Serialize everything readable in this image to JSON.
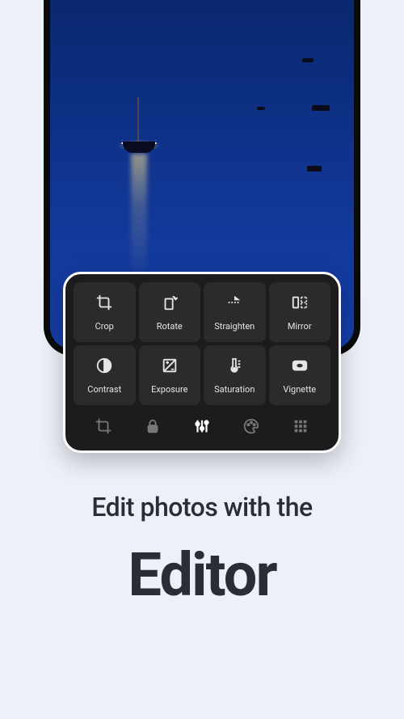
{
  "tools": [
    {
      "id": "crop",
      "label": "Crop"
    },
    {
      "id": "rotate",
      "label": "Rotate"
    },
    {
      "id": "straighten",
      "label": "Straighten"
    },
    {
      "id": "mirror",
      "label": "Mirror"
    },
    {
      "id": "contrast",
      "label": "Contrast"
    },
    {
      "id": "exposure",
      "label": "Exposure"
    },
    {
      "id": "saturation",
      "label": "Saturation"
    },
    {
      "id": "vignette",
      "label": "Vignette"
    }
  ],
  "tabs": [
    {
      "id": "transform",
      "active": false
    },
    {
      "id": "lock",
      "active": false
    },
    {
      "id": "adjust",
      "active": true
    },
    {
      "id": "color",
      "active": false
    },
    {
      "id": "grid",
      "active": false
    }
  ],
  "marketing": {
    "line1": "Edit photos with the",
    "line2": "Editor"
  }
}
